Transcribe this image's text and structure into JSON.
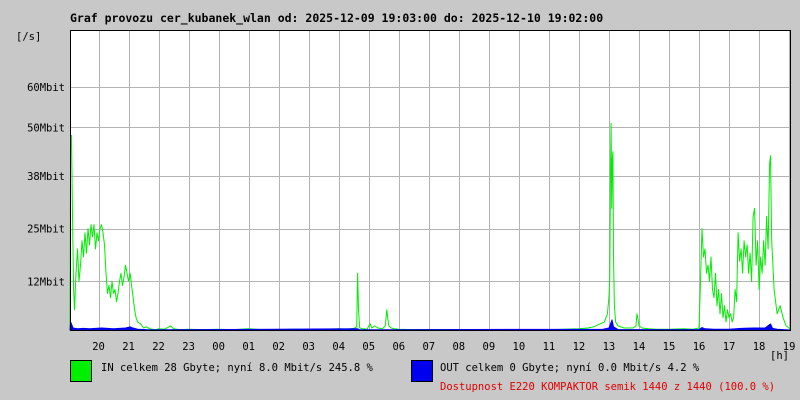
{
  "title": "Graf provozu cer_kubanek_wlan od: 2025-12-09 19:03:00 do: 2025-12-10 19:02:00",
  "y_unit": "[/s]",
  "x_unit": "[h]",
  "colors": {
    "in_fill": "#00ee00",
    "in_line": "#00ee00",
    "out_fill": "#0000ee",
    "grid": "#b4b4b4",
    "plot_bg": "#ffffff",
    "page_bg": "#c8c8c8",
    "availability": "#e00000"
  },
  "legend": {
    "in_text": "IN celkem 28 Gbyte; nyní   8.0 Mbit/s 245.8 %",
    "out_text": "OUT celkem 0 Gbyte; nyní   0.0 Mbit/s 4.2 %",
    "availability_text": "Dostupnost E220 KOMPAKTOR semik 1440 z 1440 (100.0 %)"
  },
  "chart_data": {
    "type": "area",
    "title": "Graf provozu cer_kubanek_wlan od: 2025-12-09 19:03:00 do: 2025-12-10 19:02:00",
    "xlabel": "[h]",
    "ylabel": "[/s]",
    "x_unit": "hours",
    "xlim": [
      19.05,
      43.03
    ],
    "ylim": [
      0,
      74
    ],
    "y_ticks": [
      {
        "value": 12,
        "label": "12Mbit"
      },
      {
        "value": 25,
        "label": "25Mbit"
      },
      {
        "value": 38,
        "label": "38Mbit"
      },
      {
        "value": 50,
        "label": "50Mbit"
      },
      {
        "value": 60,
        "label": "60Mbit"
      }
    ],
    "x_ticks": [
      {
        "value": 20,
        "label": "20"
      },
      {
        "value": 21,
        "label": "21"
      },
      {
        "value": 22,
        "label": "22"
      },
      {
        "value": 23,
        "label": "23"
      },
      {
        "value": 24,
        "label": "00"
      },
      {
        "value": 25,
        "label": "01"
      },
      {
        "value": 26,
        "label": "02"
      },
      {
        "value": 27,
        "label": "03"
      },
      {
        "value": 28,
        "label": "04"
      },
      {
        "value": 29,
        "label": "05"
      },
      {
        "value": 30,
        "label": "06"
      },
      {
        "value": 31,
        "label": "07"
      },
      {
        "value": 32,
        "label": "08"
      },
      {
        "value": 33,
        "label": "09"
      },
      {
        "value": 34,
        "label": "10"
      },
      {
        "value": 35,
        "label": "11"
      },
      {
        "value": 36,
        "label": "12"
      },
      {
        "value": 37,
        "label": "13"
      },
      {
        "value": 38,
        "label": "14"
      },
      {
        "value": 39,
        "label": "15"
      },
      {
        "value": 40,
        "label": "16"
      },
      {
        "value": 41,
        "label": "17"
      },
      {
        "value": 42,
        "label": "18"
      },
      {
        "value": 43,
        "label": "19"
      }
    ],
    "grid": true,
    "series": [
      {
        "name": "IN",
        "color": "#00ee00",
        "points": [
          [
            19.05,
            0
          ],
          [
            19.07,
            45
          ],
          [
            19.1,
            48
          ],
          [
            19.13,
            30
          ],
          [
            19.17,
            10
          ],
          [
            19.2,
            5
          ],
          [
            19.25,
            14
          ],
          [
            19.3,
            20
          ],
          [
            19.35,
            12
          ],
          [
            19.4,
            16
          ],
          [
            19.45,
            22
          ],
          [
            19.5,
            18
          ],
          [
            19.55,
            24
          ],
          [
            19.6,
            19
          ],
          [
            19.65,
            25
          ],
          [
            19.7,
            21
          ],
          [
            19.75,
            26
          ],
          [
            19.8,
            23
          ],
          [
            19.85,
            26
          ],
          [
            19.9,
            20
          ],
          [
            19.95,
            24
          ],
          [
            20.0,
            22
          ],
          [
            20.05,
            25
          ],
          [
            20.1,
            26
          ],
          [
            20.15,
            24
          ],
          [
            20.2,
            21
          ],
          [
            20.25,
            14
          ],
          [
            20.3,
            9
          ],
          [
            20.35,
            11
          ],
          [
            20.4,
            8
          ],
          [
            20.45,
            12
          ],
          [
            20.5,
            9
          ],
          [
            20.55,
            10
          ],
          [
            20.6,
            7
          ],
          [
            20.65,
            9
          ],
          [
            20.7,
            12
          ],
          [
            20.75,
            14
          ],
          [
            20.8,
            11
          ],
          [
            20.85,
            13
          ],
          [
            20.9,
            16
          ],
          [
            20.95,
            14
          ],
          [
            21.0,
            12
          ],
          [
            21.05,
            14
          ],
          [
            21.1,
            11
          ],
          [
            21.15,
            8
          ],
          [
            21.2,
            5
          ],
          [
            21.25,
            3
          ],
          [
            21.3,
            2
          ],
          [
            21.4,
            1.5
          ],
          [
            21.5,
            0.5
          ],
          [
            21.6,
            0.8
          ],
          [
            21.7,
            0.3
          ],
          [
            21.8,
            0.2
          ],
          [
            21.9,
            0.1
          ],
          [
            22.0,
            0.3
          ],
          [
            22.2,
            0.2
          ],
          [
            22.4,
            1.0
          ],
          [
            22.5,
            0.3
          ],
          [
            22.7,
            0.1
          ],
          [
            23.0,
            0.2
          ],
          [
            23.5,
            0.1
          ],
          [
            24.0,
            0.2
          ],
          [
            24.5,
            0.1
          ],
          [
            25.0,
            0.3
          ],
          [
            25.5,
            0.1
          ],
          [
            26.0,
            0.1
          ],
          [
            26.5,
            0.2
          ],
          [
            27.0,
            0.1
          ],
          [
            27.5,
            0.2
          ],
          [
            28.0,
            0.3
          ],
          [
            28.3,
            0.2
          ],
          [
            28.5,
            0.4
          ],
          [
            28.6,
            0.8
          ],
          [
            28.63,
            14
          ],
          [
            28.66,
            5
          ],
          [
            28.7,
            0.5
          ],
          [
            28.8,
            0.3
          ],
          [
            28.95,
            0.2
          ],
          [
            29.0,
            1.0
          ],
          [
            29.05,
            1.5
          ],
          [
            29.1,
            0.5
          ],
          [
            29.2,
            1.0
          ],
          [
            29.3,
            0.5
          ],
          [
            29.45,
            0.3
          ],
          [
            29.55,
            1.0
          ],
          [
            29.6,
            5
          ],
          [
            29.63,
            3
          ],
          [
            29.67,
            1
          ],
          [
            29.75,
            0.5
          ],
          [
            29.85,
            0.3
          ],
          [
            30.0,
            0.2
          ],
          [
            30.5,
            0.1
          ],
          [
            31.0,
            0.1
          ],
          [
            32.0,
            0.1
          ],
          [
            33.0,
            0.1
          ],
          [
            34.0,
            0.1
          ],
          [
            35.0,
            0.1
          ],
          [
            35.5,
            0.2
          ],
          [
            36.0,
            0.3
          ],
          [
            36.3,
            0.5
          ],
          [
            36.5,
            0.8
          ],
          [
            36.7,
            1.5
          ],
          [
            36.85,
            2
          ],
          [
            36.95,
            4
          ],
          [
            37.0,
            8
          ],
          [
            37.03,
            13
          ],
          [
            37.05,
            40
          ],
          [
            37.07,
            51
          ],
          [
            37.09,
            30
          ],
          [
            37.11,
            42
          ],
          [
            37.13,
            44
          ],
          [
            37.15,
            18
          ],
          [
            37.18,
            6
          ],
          [
            37.22,
            2
          ],
          [
            37.3,
            1
          ],
          [
            37.5,
            0.5
          ],
          [
            37.8,
            0.5
          ],
          [
            37.9,
            1.0
          ],
          [
            37.93,
            4
          ],
          [
            37.96,
            3
          ],
          [
            38.0,
            1
          ],
          [
            38.1,
            0.5
          ],
          [
            38.3,
            0.3
          ],
          [
            38.6,
            0.2
          ],
          [
            39.0,
            0.2
          ],
          [
            39.5,
            0.3
          ],
          [
            39.8,
            0.2
          ],
          [
            40.0,
            0.5
          ],
          [
            40.05,
            12
          ],
          [
            40.1,
            25
          ],
          [
            40.15,
            18
          ],
          [
            40.2,
            20
          ],
          [
            40.25,
            14
          ],
          [
            40.3,
            16
          ],
          [
            40.35,
            12
          ],
          [
            40.4,
            18
          ],
          [
            40.45,
            10
          ],
          [
            40.5,
            8
          ],
          [
            40.55,
            14
          ],
          [
            40.6,
            6
          ],
          [
            40.65,
            10
          ],
          [
            40.7,
            4
          ],
          [
            40.75,
            9
          ],
          [
            40.8,
            3
          ],
          [
            40.85,
            6
          ],
          [
            40.9,
            2
          ],
          [
            40.95,
            5
          ],
          [
            41.0,
            3
          ],
          [
            41.05,
            4
          ],
          [
            41.1,
            2
          ],
          [
            41.15,
            3
          ],
          [
            41.2,
            10
          ],
          [
            41.25,
            7
          ],
          [
            41.3,
            24
          ],
          [
            41.35,
            17
          ],
          [
            41.4,
            20
          ],
          [
            41.45,
            14
          ],
          [
            41.5,
            22
          ],
          [
            41.55,
            18
          ],
          [
            41.6,
            21
          ],
          [
            41.65,
            14
          ],
          [
            41.7,
            19
          ],
          [
            41.75,
            12
          ],
          [
            41.8,
            28
          ],
          [
            41.85,
            30
          ],
          [
            41.9,
            16
          ],
          [
            41.95,
            22
          ],
          [
            42.0,
            10
          ],
          [
            42.05,
            18
          ],
          [
            42.1,
            14
          ],
          [
            42.15,
            22
          ],
          [
            42.2,
            16
          ],
          [
            42.25,
            28
          ],
          [
            42.3,
            20
          ],
          [
            42.35,
            41
          ],
          [
            42.38,
            43
          ],
          [
            42.42,
            22
          ],
          [
            42.5,
            10
          ],
          [
            42.6,
            4
          ],
          [
            42.7,
            6
          ],
          [
            42.8,
            3
          ],
          [
            42.9,
            1
          ],
          [
            43.0,
            0.5
          ],
          [
            43.03,
            0
          ]
        ]
      },
      {
        "name": "OUT",
        "color": "#0000ee",
        "points": [
          [
            19.05,
            0
          ],
          [
            19.07,
            2
          ],
          [
            19.1,
            1.5
          ],
          [
            19.15,
            0.5
          ],
          [
            19.3,
            0.3
          ],
          [
            19.5,
            0.4
          ],
          [
            19.7,
            0.3
          ],
          [
            19.9,
            0.4
          ],
          [
            20.1,
            0.5
          ],
          [
            20.3,
            0.4
          ],
          [
            20.5,
            0.3
          ],
          [
            20.7,
            0.4
          ],
          [
            20.9,
            0.5
          ],
          [
            21.05,
            0.8
          ],
          [
            21.1,
            0.6
          ],
          [
            21.3,
            0.2
          ],
          [
            21.6,
            0.1
          ],
          [
            22.0,
            0.05
          ],
          [
            28.63,
            0.3
          ],
          [
            28.7,
            0.05
          ],
          [
            36.8,
            0.2
          ],
          [
            37.0,
            0.5
          ],
          [
            37.05,
            1.5
          ],
          [
            37.1,
            2.5
          ],
          [
            37.15,
            0.8
          ],
          [
            37.3,
            0.1
          ],
          [
            40.0,
            0.1
          ],
          [
            40.1,
            0.6
          ],
          [
            40.2,
            0.3
          ],
          [
            40.5,
            0.2
          ],
          [
            41.0,
            0.2
          ],
          [
            41.4,
            0.4
          ],
          [
            41.8,
            0.5
          ],
          [
            42.2,
            0.5
          ],
          [
            42.38,
            1.5
          ],
          [
            42.45,
            0.4
          ],
          [
            42.6,
            0.2
          ],
          [
            43.03,
            0
          ]
        ]
      }
    ]
  }
}
